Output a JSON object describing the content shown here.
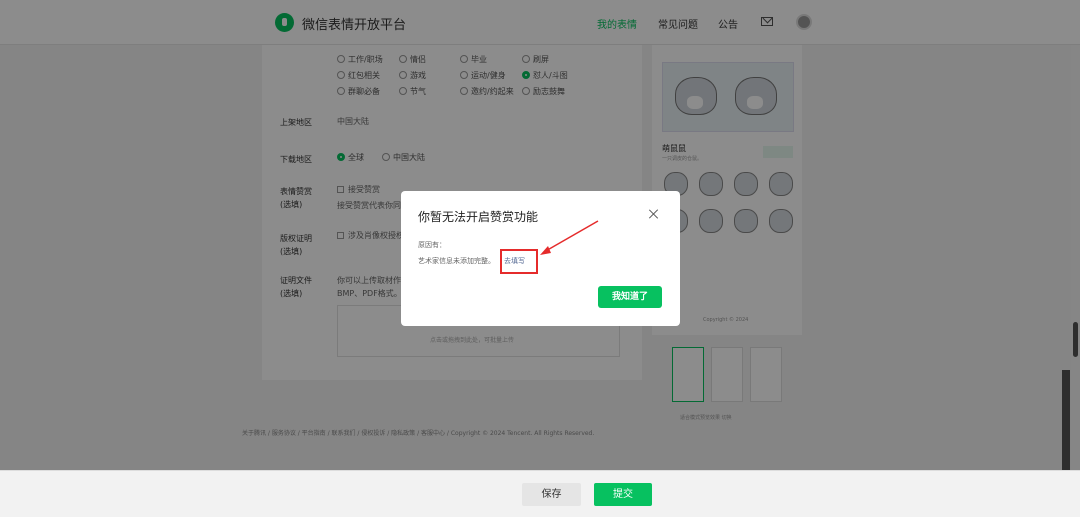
{
  "header": {
    "brand": "微信表情开放平台",
    "nav": [
      "我的表情",
      "常见问题",
      "公告"
    ]
  },
  "tags": {
    "row1": [
      "工作/职场",
      "情侣",
      "毕业",
      "刷屏"
    ],
    "row2": [
      "红包相关",
      "游戏",
      "运动/健身",
      "怼人/斗图"
    ],
    "row3": [
      "群聊必备",
      "节气",
      "邀约/约起来",
      "励志鼓舞"
    ]
  },
  "form": {
    "region_label": "上架地区",
    "region_value": "中国大陆",
    "download_label": "下载地区",
    "download_options": [
      "全球",
      "中国大陆"
    ],
    "tip_label": "表情赞赏",
    "tip_optional": "(选填)",
    "tip_checkbox": "接受赞赏",
    "tip_desc": "接受赞赏代表你同",
    "copyright_label": "版权证明",
    "copyright_optional": "(选填)",
    "copyright_checkbox": "涉及肖像权授权",
    "proof_label": "证明文件",
    "proof_optional": "(选填)",
    "proof_desc_1": "你可以上传取材作",
    "proof_desc_2": "BMP、PDF格式。",
    "upload_hint": "点击或拖拽到此处，可批量上传"
  },
  "preview": {
    "title": "萌鼠鼠",
    "subtitle": "一只调皮的仓鼠。",
    "copyright": "Copyright © 2024",
    "thumbnail_hint": "适合模式预览效果",
    "thumbnail_switch": "切换"
  },
  "footer": {
    "links": "关于腾讯 / 服务协议 / 平台指南 / 联系我们 / 侵权投诉 / 隐私政策 / 客服中心 / Copyright © 2024 Tencent. All Rights Reserved."
  },
  "dialog": {
    "title": "你暂无法开启赞赏功能",
    "reason_label": "原因有：",
    "reason_text": "艺术家信息未添加完整。",
    "link_text": "去填写",
    "ok_button": "我知道了"
  },
  "actions": {
    "save": "保存",
    "submit": "提交"
  },
  "colors": {
    "accent": "#07c160",
    "highlight": "#e52b2b",
    "link": "#576b95"
  }
}
